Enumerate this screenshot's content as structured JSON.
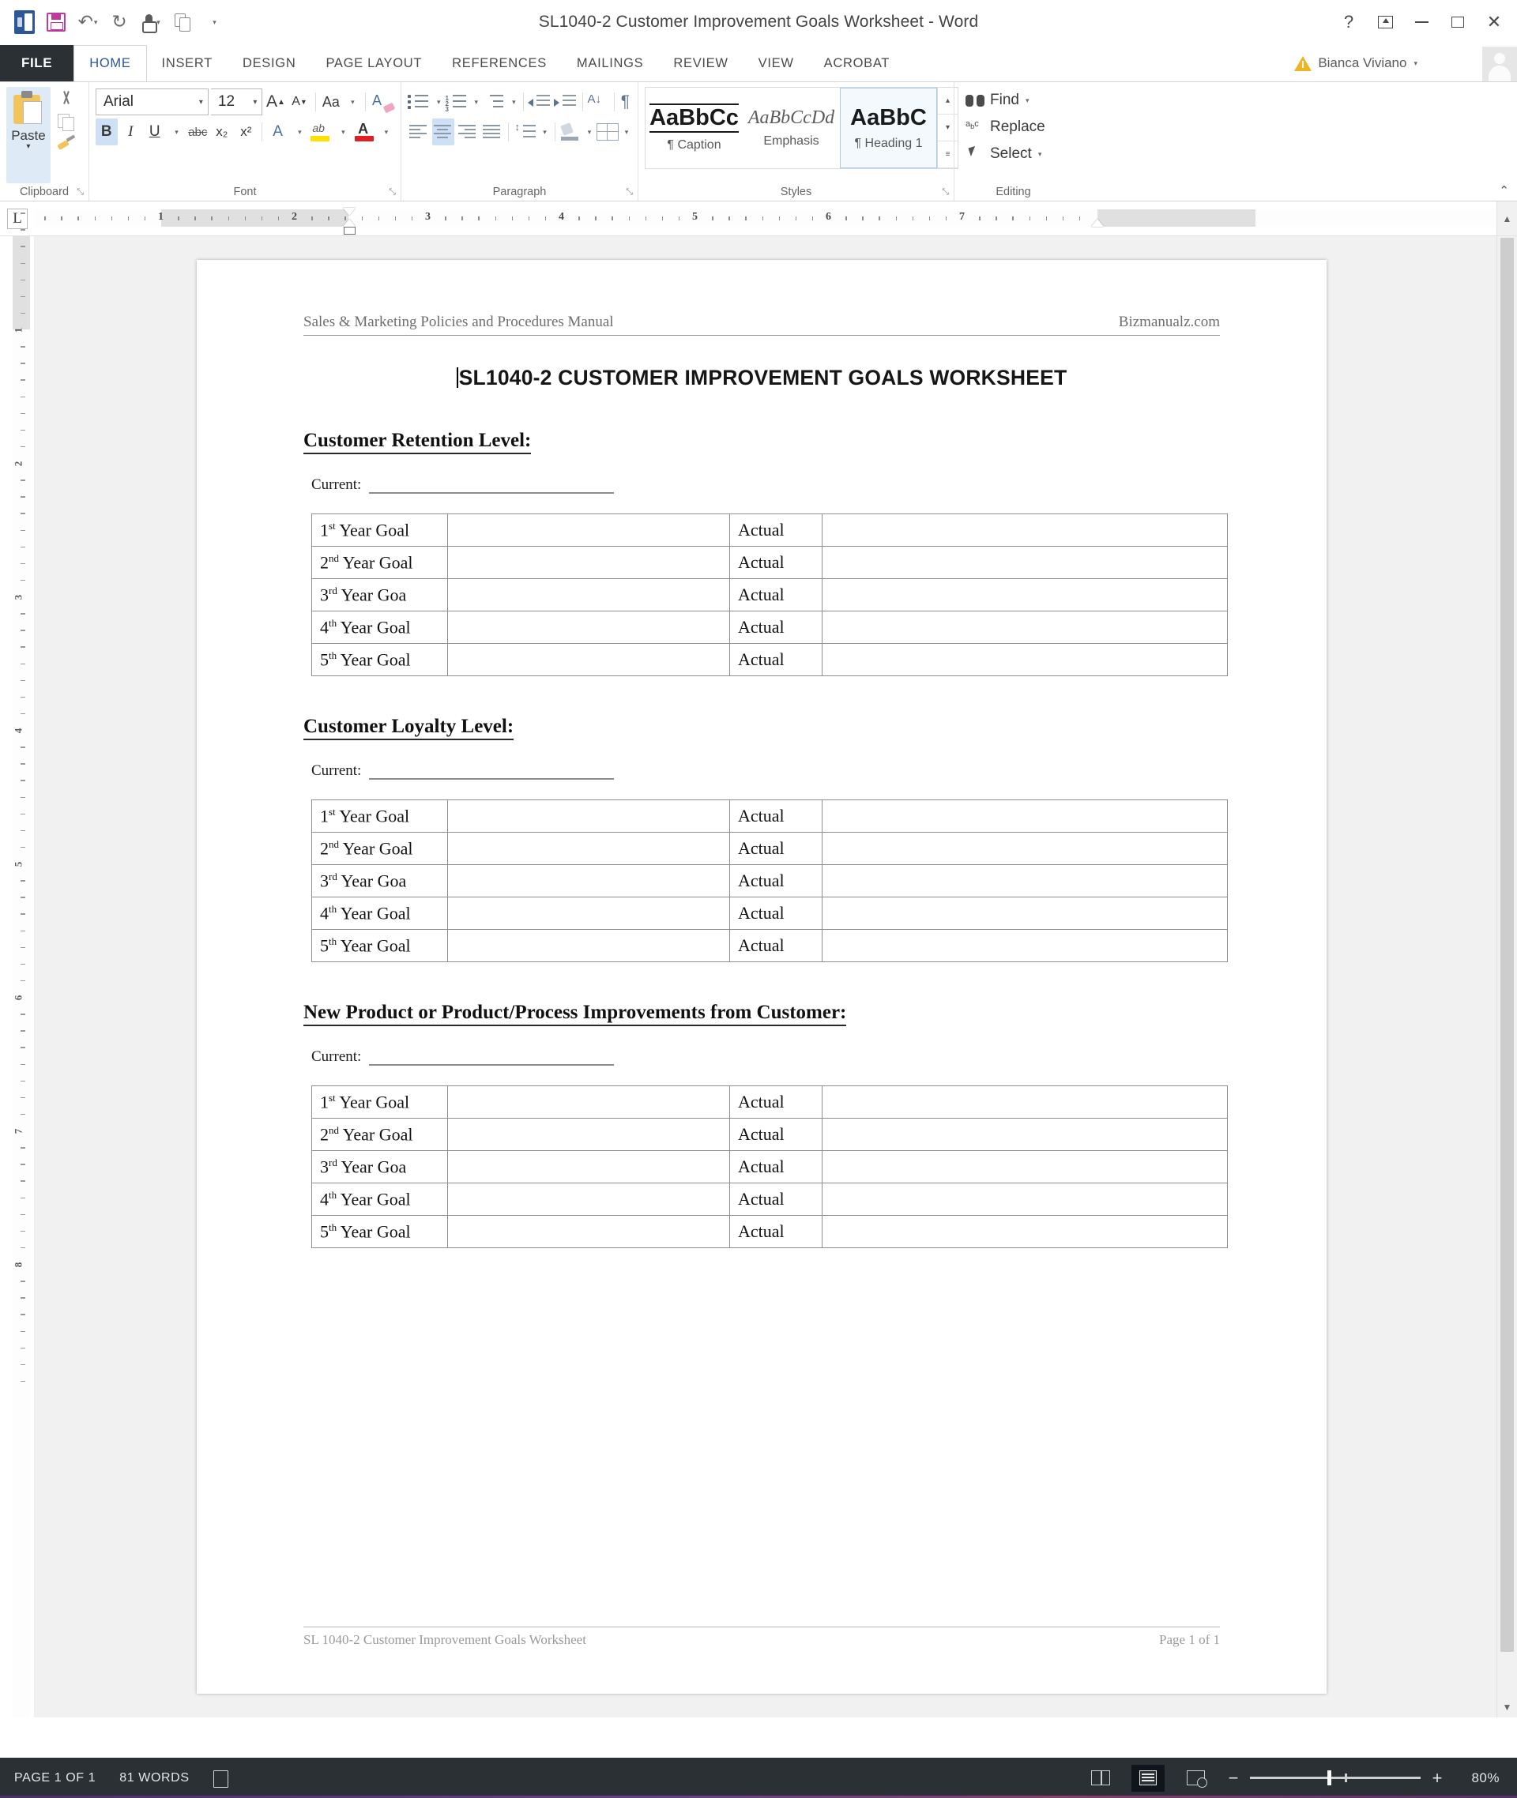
{
  "titlebar": {
    "document_title": "SL1040-2 Customer Improvement Goals Worksheet - Word",
    "qat": [
      {
        "name": "word-logo",
        "label": "W"
      },
      {
        "name": "save-icon",
        "label": ""
      },
      {
        "name": "undo-icon",
        "label": "↶"
      },
      {
        "name": "redo-icon",
        "label": "↻"
      },
      {
        "name": "touch-mode-icon",
        "label": ""
      },
      {
        "name": "copy-icon",
        "label": ""
      },
      {
        "name": "customize-qat-icon",
        "label": "▾"
      }
    ],
    "help_label": "?",
    "ribbon_display_label": "☰",
    "minimize_label": "—",
    "maximize_label": "□",
    "close_label": "✕"
  },
  "tabs": {
    "file_label": "FILE",
    "items": [
      {
        "label": "HOME",
        "active": true
      },
      {
        "label": "INSERT",
        "active": false
      },
      {
        "label": "DESIGN",
        "active": false
      },
      {
        "label": "PAGE LAYOUT",
        "active": false
      },
      {
        "label": "REFERENCES",
        "active": false
      },
      {
        "label": "MAILINGS",
        "active": false
      },
      {
        "label": "REVIEW",
        "active": false
      },
      {
        "label": "VIEW",
        "active": false
      },
      {
        "label": "ACROBAT",
        "active": false
      }
    ],
    "account_name": "Bianca Viviano",
    "account_caret": "▾"
  },
  "ribbon": {
    "clipboard": {
      "group_label": "Clipboard",
      "paste_label": "Paste",
      "paste_caret": "▾",
      "cut_name": "cut-icon",
      "copy_name": "copy-icon",
      "format_painter_name": "format-painter-icon",
      "dialog_launcher": "⤡"
    },
    "font": {
      "group_label": "Font",
      "font_name": "Arial",
      "font_size": "12",
      "caret": "▾",
      "grow_font": "A",
      "shrink_font": "A",
      "change_case": "Aa",
      "bold": "B",
      "italic": "I",
      "underline": "U",
      "strikethrough": "abc",
      "subscript": "x₂",
      "superscript": "x²",
      "dialog_launcher": "⤡"
    },
    "paragraph": {
      "group_label": "Paragraph",
      "dialog_launcher": "⤡"
    },
    "styles": {
      "group_label": "Styles",
      "items": [
        {
          "preview": "AaBbCc",
          "name": "¶ Caption",
          "selected": false
        },
        {
          "preview": "AaBbCcDd",
          "name": "Emphasis",
          "selected": false
        },
        {
          "preview": "AaBbC",
          "name": "¶ Heading 1",
          "selected": true
        }
      ],
      "nav_up": "▴",
      "nav_down": "▾",
      "nav_more": "≡",
      "dialog_launcher": "⤡"
    },
    "editing": {
      "group_label": "Editing",
      "find_label": "Find",
      "find_caret": "▾",
      "replace_label": "Replace",
      "select_label": "Select",
      "select_caret": "▾"
    },
    "collapse_label": "⌃"
  },
  "ruler": {
    "tab_stop_label": "L",
    "h_ticks": [
      "1",
      "2",
      "3",
      "4",
      "5",
      "6",
      "7"
    ],
    "v_ticks": [
      "1",
      "2",
      "3",
      "4",
      "5",
      "6",
      "7",
      "8"
    ]
  },
  "document": {
    "header_left": "Sales & Marketing Policies and Procedures Manual",
    "header_right": "Bizmanualz.com",
    "title": "SL1040-2 CUSTOMER IMPROVEMENT GOALS WORKSHEET",
    "current_label": "Current:",
    "actual_label": "Actual",
    "row_labels": [
      {
        "ord": "1",
        "sup": "st",
        "rest": " Year Goal"
      },
      {
        "ord": "2",
        "sup": "nd",
        "rest": " Year Goal"
      },
      {
        "ord": "3",
        "sup": "rd",
        "rest": " Year Goa"
      },
      {
        "ord": "4",
        "sup": "th",
        "rest": " Year Goal"
      },
      {
        "ord": "5",
        "sup": "th",
        "rest": " Year Goal"
      }
    ],
    "sections": [
      {
        "heading": "Customer Retention Level:"
      },
      {
        "heading": "Customer Loyalty Level:"
      },
      {
        "heading": "New Product or Product/Process Improvements from Customer:"
      }
    ],
    "footer_left": "SL 1040-2 Customer Improvement Goals Worksheet",
    "footer_right": "Page 1 of 1"
  },
  "statusbar": {
    "page_status": "PAGE 1 OF 1",
    "word_count": "81 WORDS",
    "proofing_icon": "proofing-errors-icon",
    "view_read_mode": "read-mode-icon",
    "view_print_layout": "print-layout-icon",
    "view_web_layout": "web-layout-icon",
    "zoom_out": "−",
    "zoom_in": "+",
    "zoom_level": "80%"
  }
}
